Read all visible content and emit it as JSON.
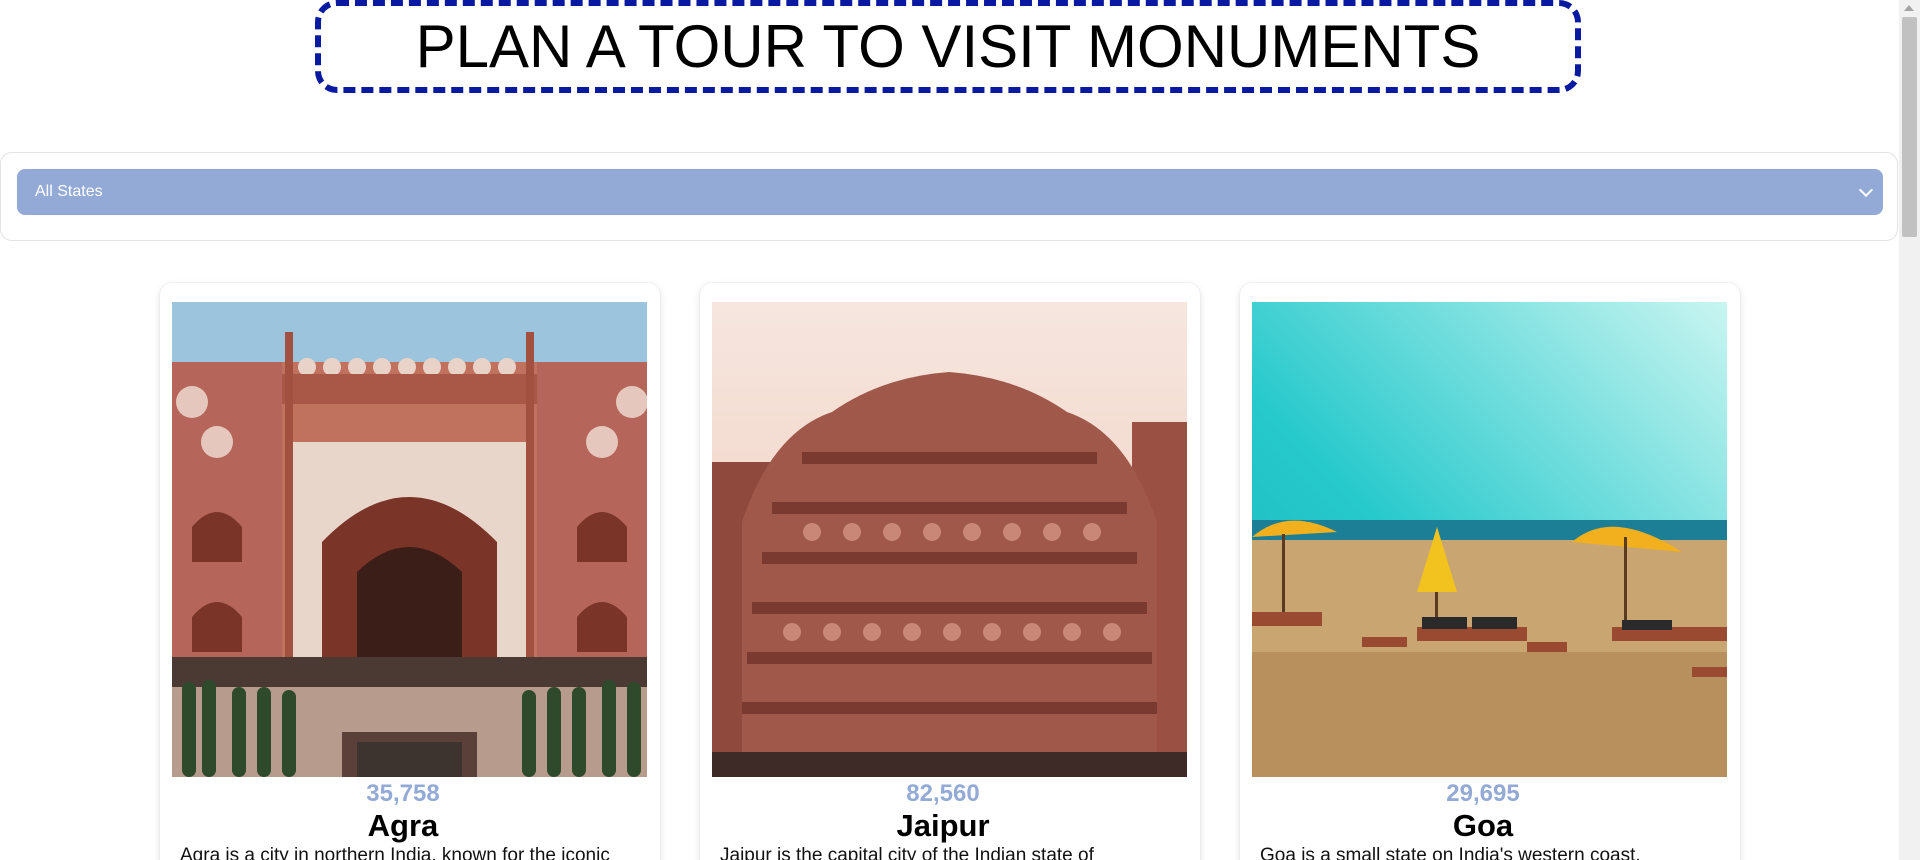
{
  "header": {
    "title": "PLAN A TOUR TO VISIT MONUMENTS"
  },
  "filter": {
    "selected_state": "All States"
  },
  "cards": [
    {
      "count": "35,758",
      "city": "Agra",
      "description": "Agra is a city in northern India, known for the iconic",
      "image": "agra-gate-photo"
    },
    {
      "count": "82,560",
      "city": "Jaipur",
      "description": "Jaipur is the capital city of the Indian state of",
      "image": "jaipur-hawa-mahal-photo"
    },
    {
      "count": "29,695",
      "city": "Goa",
      "description": "Goa is a small state on India's western coast,",
      "image": "goa-beach-photo"
    }
  ],
  "colors": {
    "accent": "#93aad6",
    "title_border": "#0a1aa0"
  }
}
